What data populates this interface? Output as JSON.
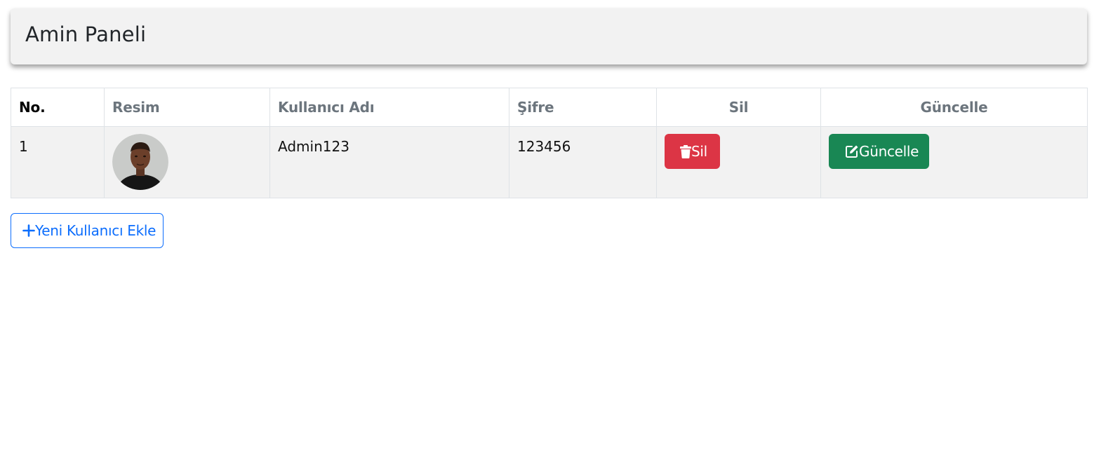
{
  "header": {
    "title": "Amin Paneli"
  },
  "table": {
    "columns": [
      "No.",
      "Resim",
      "Kullanıcı Adı",
      "Şifre",
      "Sil",
      "Güncelle"
    ],
    "rows": [
      {
        "no": "1",
        "avatar": "user-avatar-photo",
        "username": "Admin123",
        "password": "123456",
        "delete_label": "Sil",
        "update_label": "Güncelle"
      }
    ]
  },
  "actions": {
    "add_user_label": "Yeni Kullanıcı Ekle"
  },
  "icons": {
    "delete": "trash-icon",
    "update": "edit-icon",
    "add": "plus-icon"
  },
  "colors": {
    "danger": "#dc3545",
    "success": "#198754",
    "primary": "#0d6efd",
    "header_bg": "#f2f2f2",
    "header_muted": "#6c757d"
  }
}
